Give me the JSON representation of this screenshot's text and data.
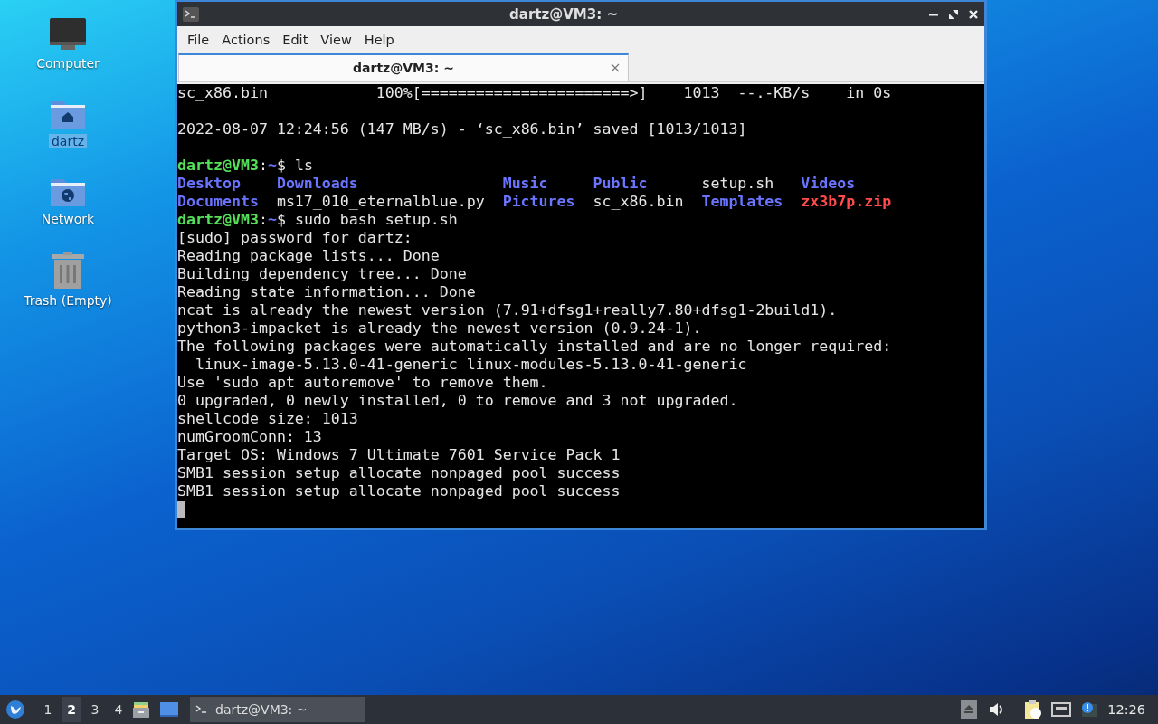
{
  "desktop_icons": [
    {
      "kind": "computer",
      "label": "Computer",
      "selected": false
    },
    {
      "kind": "home",
      "label": "dartz",
      "selected": true
    },
    {
      "kind": "network",
      "label": "Network",
      "selected": false
    },
    {
      "kind": "trash",
      "label": "Trash (Empty)",
      "selected": false
    }
  ],
  "window": {
    "title": "dartz@VM3: ~",
    "menu": [
      "File",
      "Actions",
      "Edit",
      "View",
      "Help"
    ],
    "tabs": [
      {
        "title": "dartz@VM3: ~",
        "selected": true
      }
    ],
    "terminal": {
      "lines": [
        {
          "kind": "text",
          "segments": [
            {
              "text": "sc_x86.bin            100%[=======================>]    1013  --.-KB/s    in 0s",
              "kind": "plain"
            }
          ]
        },
        {
          "kind": "blank"
        },
        {
          "kind": "text",
          "segments": [
            {
              "text": "2022-08-07 12:24:56 (147 MB/s) - ‘sc_x86.bin’ saved [1013/1013]",
              "kind": "plain"
            }
          ]
        },
        {
          "kind": "blank"
        },
        {
          "kind": "text",
          "segments": [
            {
              "text": "dartz@VM3",
              "kind": "user"
            },
            {
              "text": ":",
              "kind": "plain"
            },
            {
              "text": "~",
              "kind": "path"
            },
            {
              "text": "$ ls",
              "kind": "plain"
            }
          ]
        },
        {
          "kind": "files",
          "items": [
            {
              "name": "Desktop",
              "kind": "dir"
            },
            {
              "name": "Downloads",
              "kind": "dir"
            },
            {
              "name": "Music",
              "kind": "dir"
            },
            {
              "name": "Public",
              "kind": "dir"
            },
            {
              "name": "setup.sh",
              "kind": "plain"
            },
            {
              "name": "Videos",
              "kind": "dir"
            }
          ]
        },
        {
          "kind": "files",
          "items": [
            {
              "name": "Documents",
              "kind": "dir"
            },
            {
              "name": "ms17_010_eternalblue.py",
              "kind": "plain"
            },
            {
              "name": "Pictures",
              "kind": "dir"
            },
            {
              "name": "sc_x86.bin",
              "kind": "plain"
            },
            {
              "name": "Templates",
              "kind": "dir"
            },
            {
              "name": "zx3b7p.zip",
              "kind": "archive"
            }
          ]
        },
        {
          "kind": "text",
          "segments": [
            {
              "text": "dartz@VM3",
              "kind": "user"
            },
            {
              "text": ":",
              "kind": "plain"
            },
            {
              "text": "~",
              "kind": "path"
            },
            {
              "text": "$ sudo bash setup.sh",
              "kind": "plain"
            }
          ]
        },
        {
          "kind": "text",
          "segments": [
            {
              "text": "[sudo] password for dartz:",
              "kind": "plain"
            }
          ]
        },
        {
          "kind": "text",
          "segments": [
            {
              "text": "Reading package lists... Done",
              "kind": "plain"
            }
          ]
        },
        {
          "kind": "text",
          "segments": [
            {
              "text": "Building dependency tree... Done",
              "kind": "plain"
            }
          ]
        },
        {
          "kind": "text",
          "segments": [
            {
              "text": "Reading state information... Done",
              "kind": "plain"
            }
          ]
        },
        {
          "kind": "text",
          "segments": [
            {
              "text": "ncat is already the newest version (7.91+dfsg1+really7.80+dfsg1-2build1).",
              "kind": "plain"
            }
          ]
        },
        {
          "kind": "text",
          "segments": [
            {
              "text": "python3-impacket is already the newest version (0.9.24-1).",
              "kind": "plain"
            }
          ]
        },
        {
          "kind": "text",
          "segments": [
            {
              "text": "The following packages were automatically installed and are no longer required:",
              "kind": "plain"
            }
          ]
        },
        {
          "kind": "text",
          "segments": [
            {
              "text": "  linux-image-5.13.0-41-generic linux-modules-5.13.0-41-generic",
              "kind": "plain"
            }
          ]
        },
        {
          "kind": "text",
          "segments": [
            {
              "text": "Use 'sudo apt autoremove' to remove them.",
              "kind": "plain"
            }
          ]
        },
        {
          "kind": "text",
          "segments": [
            {
              "text": "0 upgraded, 0 newly installed, 0 to remove and 3 not upgraded.",
              "kind": "plain"
            }
          ]
        },
        {
          "kind": "text",
          "segments": [
            {
              "text": "shellcode size: 1013",
              "kind": "plain"
            }
          ]
        },
        {
          "kind": "text",
          "segments": [
            {
              "text": "numGroomConn: 13",
              "kind": "plain"
            }
          ]
        },
        {
          "kind": "text",
          "segments": [
            {
              "text": "Target OS: Windows 7 Ultimate 7601 Service Pack 1",
              "kind": "plain"
            }
          ]
        },
        {
          "kind": "text",
          "segments": [
            {
              "text": "SMB1 session setup allocate nonpaged pool success",
              "kind": "plain"
            }
          ]
        },
        {
          "kind": "text",
          "segments": [
            {
              "text": "SMB1 session setup allocate nonpaged pool success",
              "kind": "plain"
            }
          ]
        },
        {
          "kind": "cursor"
        }
      ]
    }
  },
  "taskbar": {
    "workspaces": [
      {
        "label": "1",
        "selected": false
      },
      {
        "label": "2",
        "selected": true
      },
      {
        "label": "3",
        "selected": false
      },
      {
        "label": "4",
        "selected": false
      }
    ],
    "tasks": [
      {
        "title": "dartz@VM3: ~",
        "selected": true
      }
    ],
    "clock": "12:26"
  }
}
